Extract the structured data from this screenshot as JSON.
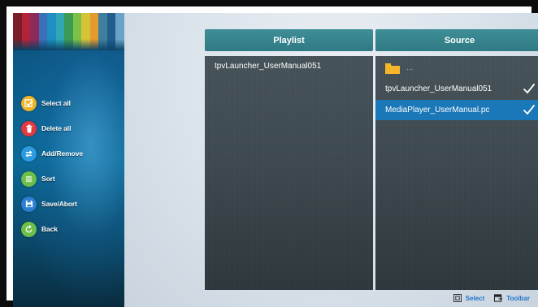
{
  "sidebar": {
    "stripe_colors": [
      "#7a1f2a",
      "#b3233a",
      "#8c2a5a",
      "#3b6fb7",
      "#1e8fc0",
      "#2fa7b5",
      "#3c9a54",
      "#7cc04a",
      "#d7c337",
      "#e59a2e",
      "#3e7f9e",
      "#1f5e8f",
      "#6aa3c8"
    ],
    "menu": [
      {
        "label": "Select all",
        "icon": "select-all-icon",
        "color": "#f0b429"
      },
      {
        "label": "Delete all",
        "icon": "trash-icon",
        "color": "#e0393e"
      },
      {
        "label": "Add/Remove",
        "icon": "swap-icon",
        "color": "#2a9be0"
      },
      {
        "label": "Sort",
        "icon": "sort-icon",
        "color": "#6cc04a"
      },
      {
        "label": "Save/Abort",
        "icon": "save-icon",
        "color": "#2a7fd1"
      },
      {
        "label": "Back",
        "icon": "back-icon",
        "color": "#6cc04a"
      }
    ]
  },
  "playlist": {
    "header": "Playlist",
    "items": [
      "tpvLauncher_UserManual051"
    ]
  },
  "source": {
    "header": "Source",
    "folder_label": "...",
    "items": [
      {
        "label": "tpvLauncher_UserManual051",
        "checked": true,
        "selected": false
      },
      {
        "label": "MediaPlayer_UserManual.pc",
        "checked": true,
        "selected": true
      }
    ]
  },
  "hints": {
    "select": "Select",
    "toolbar": "Toolbar"
  }
}
